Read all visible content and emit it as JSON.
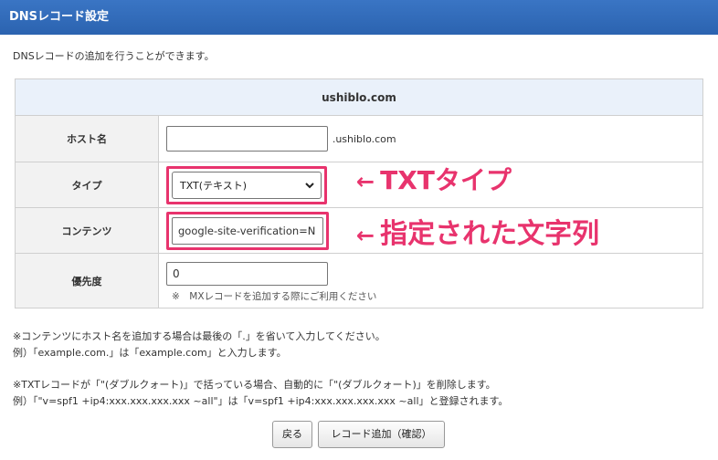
{
  "header": {
    "title": "DNSレコード設定"
  },
  "intro": "DNSレコードの追加を行うことができます。",
  "form": {
    "domain": "ushiblo.com",
    "host": {
      "label": "ホスト名",
      "value": "",
      "suffix": ".ushiblo.com"
    },
    "type": {
      "label": "タイプ",
      "selected": "TXT(テキスト)"
    },
    "content": {
      "label": "コンテンツ",
      "value": "google-site-verification=N"
    },
    "priority": {
      "label": "優先度",
      "value": "0",
      "note": "※　MXレコードを追加する際にご利用ください"
    }
  },
  "annotations": {
    "arrow": "←",
    "type_note": "TXTタイプ",
    "content_note": "指定された文字列",
    "color": "#e8336d"
  },
  "notes": {
    "line1": "※コンテンツにホスト名を追加する場合は最後の「.」を省いて入力してください。",
    "line2": "例）「example.com.」は「example.com」と入力します。",
    "line3": "※TXTレコードが「\"(ダブルクォート)」で括っている場合、自動的に「\"(ダブルクォート)」を削除します。",
    "line4": "例）「\"v=spf1 +ip4:xxx.xxx.xxx.xxx ~all\"」は「v=spf1 +ip4:xxx.xxx.xxx.xxx ~all」と登録されます。"
  },
  "buttons": {
    "back": "戻る",
    "add": "レコード追加（確認）"
  },
  "colors": {
    "header_bg": "#2b63b0",
    "accent": "#e8336d"
  }
}
